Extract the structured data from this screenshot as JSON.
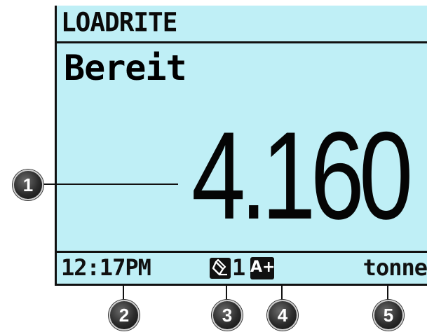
{
  "display": {
    "brand": "LOADRITE",
    "status": "Bereit",
    "weight": "4.160",
    "time": "12:17PM",
    "bucket_count": "1",
    "mode_label": "A+",
    "unit": "tonne"
  },
  "icons": {
    "bucket": "bucket-icon",
    "mode": "auto-add-icon"
  },
  "callouts": [
    "1",
    "2",
    "3",
    "4",
    "5"
  ],
  "colors": {
    "lcd_background": "#bfeff6",
    "lcd_text": "#000000",
    "callout": "#2b2b2b"
  }
}
